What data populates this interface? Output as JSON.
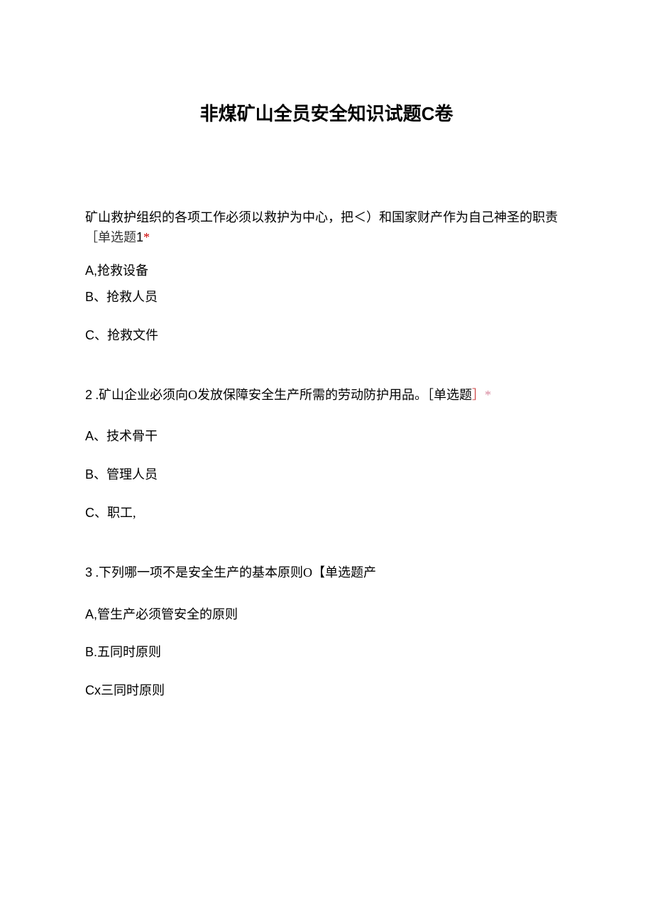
{
  "title": "非煤矿山全员安全知识试题C卷",
  "q1": {
    "text_line1": "矿山救护组织的各项工作必须以救护为中心，把＜）和国家财产作为自己神圣的职责",
    "tag_prefix": "［单选题",
    "tag_num": "1",
    "asterisk": "*",
    "opt_a_label": "A,",
    "opt_a_text": "抢救设备",
    "opt_b_label": "B、",
    "opt_b_text": "抢救人员",
    "opt_c_label": "C、",
    "opt_c_text": "抢救文件"
  },
  "q2": {
    "num": "2",
    "text": " .矿山企业必须向O发放保障安全生产所需的劳动防护用品。［单选题",
    "bracket": "］",
    "asterisk": "*",
    "opt_a_label": "A、",
    "opt_a_text": "技术骨干",
    "opt_b_label": "B、",
    "opt_b_text": "管理人员",
    "opt_c_label": "C、",
    "opt_c_text": "职工,"
  },
  "q3": {
    "num": "3",
    "text": " .下列哪一项不是安全生产的基本原则O【单选题产",
    "opt_a_label": "A,",
    "opt_a_text": "管生产必须管安全的原则",
    "opt_b_label": "B.",
    "opt_b_text": "五同时原则",
    "opt_c_label": "Cx",
    "opt_c_text": "三同时原则"
  }
}
